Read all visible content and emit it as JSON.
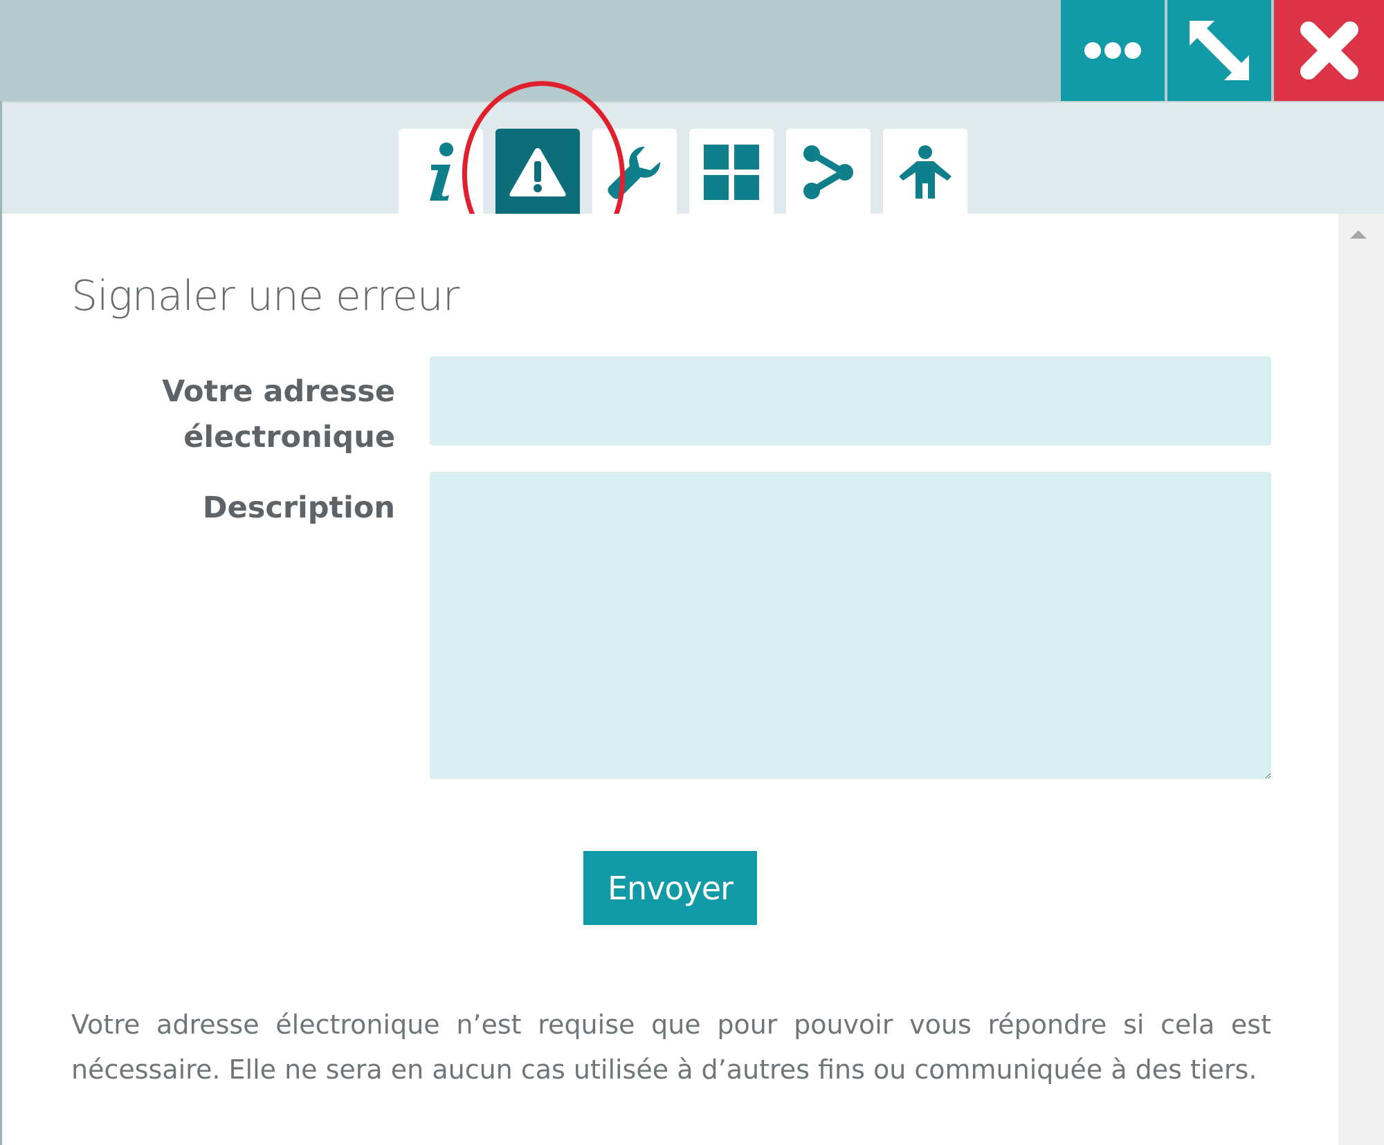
{
  "window": {
    "controls": [
      {
        "name": "more-options",
        "icon": "ellipsis-icon"
      },
      {
        "name": "expand",
        "icon": "expand-diagonal-icon"
      },
      {
        "name": "close",
        "icon": "close-x-icon"
      }
    ]
  },
  "tabs": [
    {
      "icon": "info-icon",
      "active": false
    },
    {
      "icon": "warning-triangle-icon",
      "active": true
    },
    {
      "icon": "wrench-icon",
      "active": false
    },
    {
      "icon": "grid-icon",
      "active": false
    },
    {
      "icon": "share-icon",
      "active": false
    },
    {
      "icon": "accessibility-person-icon",
      "active": false
    }
  ],
  "form": {
    "title": "Signaler une erreur",
    "email_label": "Votre adresse électronique",
    "email_value": "",
    "description_label": "Description",
    "description_value": "",
    "submit_label": "Envoyer",
    "privacy_note": "Votre adresse électronique n’est requise que pour pouvoir vous répondre si cela est nécessaire. Elle ne sera en aucun cas utilisée à d’autres fins ou communiquée à des tiers."
  },
  "colors": {
    "accent": "#139aa7",
    "active_tab": "#0d6e7a",
    "close": "#dd3346",
    "field_bg": "#daeff2",
    "highlight": "#e0202d"
  }
}
